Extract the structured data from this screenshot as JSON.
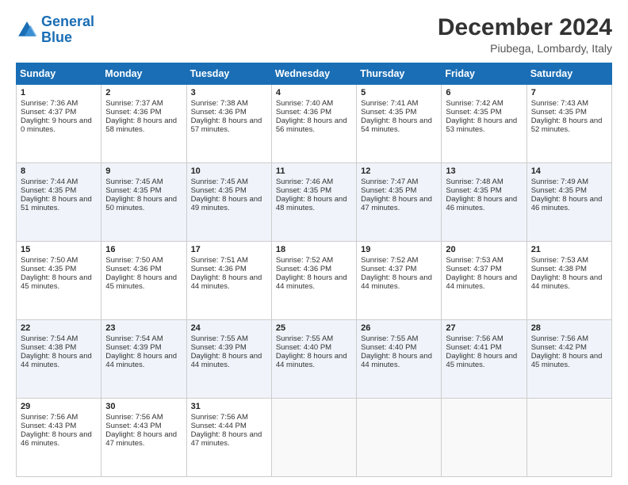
{
  "logo": {
    "line1": "General",
    "line2": "Blue"
  },
  "header": {
    "month": "December 2024",
    "location": "Piubega, Lombardy, Italy"
  },
  "days_of_week": [
    "Sunday",
    "Monday",
    "Tuesday",
    "Wednesday",
    "Thursday",
    "Friday",
    "Saturday"
  ],
  "weeks": [
    [
      {
        "day": "1",
        "sunrise": "7:36 AM",
        "sunset": "4:37 PM",
        "daylight": "9 hours and 0 minutes."
      },
      {
        "day": "2",
        "sunrise": "7:37 AM",
        "sunset": "4:36 PM",
        "daylight": "8 hours and 58 minutes."
      },
      {
        "day": "3",
        "sunrise": "7:38 AM",
        "sunset": "4:36 PM",
        "daylight": "8 hours and 57 minutes."
      },
      {
        "day": "4",
        "sunrise": "7:40 AM",
        "sunset": "4:36 PM",
        "daylight": "8 hours and 56 minutes."
      },
      {
        "day": "5",
        "sunrise": "7:41 AM",
        "sunset": "4:35 PM",
        "daylight": "8 hours and 54 minutes."
      },
      {
        "day": "6",
        "sunrise": "7:42 AM",
        "sunset": "4:35 PM",
        "daylight": "8 hours and 53 minutes."
      },
      {
        "day": "7",
        "sunrise": "7:43 AM",
        "sunset": "4:35 PM",
        "daylight": "8 hours and 52 minutes."
      }
    ],
    [
      {
        "day": "8",
        "sunrise": "7:44 AM",
        "sunset": "4:35 PM",
        "daylight": "8 hours and 51 minutes."
      },
      {
        "day": "9",
        "sunrise": "7:45 AM",
        "sunset": "4:35 PM",
        "daylight": "8 hours and 50 minutes."
      },
      {
        "day": "10",
        "sunrise": "7:45 AM",
        "sunset": "4:35 PM",
        "daylight": "8 hours and 49 minutes."
      },
      {
        "day": "11",
        "sunrise": "7:46 AM",
        "sunset": "4:35 PM",
        "daylight": "8 hours and 48 minutes."
      },
      {
        "day": "12",
        "sunrise": "7:47 AM",
        "sunset": "4:35 PM",
        "daylight": "8 hours and 47 minutes."
      },
      {
        "day": "13",
        "sunrise": "7:48 AM",
        "sunset": "4:35 PM",
        "daylight": "8 hours and 46 minutes."
      },
      {
        "day": "14",
        "sunrise": "7:49 AM",
        "sunset": "4:35 PM",
        "daylight": "8 hours and 46 minutes."
      }
    ],
    [
      {
        "day": "15",
        "sunrise": "7:50 AM",
        "sunset": "4:35 PM",
        "daylight": "8 hours and 45 minutes."
      },
      {
        "day": "16",
        "sunrise": "7:50 AM",
        "sunset": "4:36 PM",
        "daylight": "8 hours and 45 minutes."
      },
      {
        "day": "17",
        "sunrise": "7:51 AM",
        "sunset": "4:36 PM",
        "daylight": "8 hours and 44 minutes."
      },
      {
        "day": "18",
        "sunrise": "7:52 AM",
        "sunset": "4:36 PM",
        "daylight": "8 hours and 44 minutes."
      },
      {
        "day": "19",
        "sunrise": "7:52 AM",
        "sunset": "4:37 PM",
        "daylight": "8 hours and 44 minutes."
      },
      {
        "day": "20",
        "sunrise": "7:53 AM",
        "sunset": "4:37 PM",
        "daylight": "8 hours and 44 minutes."
      },
      {
        "day": "21",
        "sunrise": "7:53 AM",
        "sunset": "4:38 PM",
        "daylight": "8 hours and 44 minutes."
      }
    ],
    [
      {
        "day": "22",
        "sunrise": "7:54 AM",
        "sunset": "4:38 PM",
        "daylight": "8 hours and 44 minutes."
      },
      {
        "day": "23",
        "sunrise": "7:54 AM",
        "sunset": "4:39 PM",
        "daylight": "8 hours and 44 minutes."
      },
      {
        "day": "24",
        "sunrise": "7:55 AM",
        "sunset": "4:39 PM",
        "daylight": "8 hours and 44 minutes."
      },
      {
        "day": "25",
        "sunrise": "7:55 AM",
        "sunset": "4:40 PM",
        "daylight": "8 hours and 44 minutes."
      },
      {
        "day": "26",
        "sunrise": "7:55 AM",
        "sunset": "4:40 PM",
        "daylight": "8 hours and 44 minutes."
      },
      {
        "day": "27",
        "sunrise": "7:56 AM",
        "sunset": "4:41 PM",
        "daylight": "8 hours and 45 minutes."
      },
      {
        "day": "28",
        "sunrise": "7:56 AM",
        "sunset": "4:42 PM",
        "daylight": "8 hours and 45 minutes."
      }
    ],
    [
      {
        "day": "29",
        "sunrise": "7:56 AM",
        "sunset": "4:43 PM",
        "daylight": "8 hours and 46 minutes."
      },
      {
        "day": "30",
        "sunrise": "7:56 AM",
        "sunset": "4:43 PM",
        "daylight": "8 hours and 47 minutes."
      },
      {
        "day": "31",
        "sunrise": "7:56 AM",
        "sunset": "4:44 PM",
        "daylight": "8 hours and 47 minutes."
      },
      null,
      null,
      null,
      null
    ]
  ],
  "labels": {
    "sunrise": "Sunrise:",
    "sunset": "Sunset:",
    "daylight": "Daylight:"
  }
}
